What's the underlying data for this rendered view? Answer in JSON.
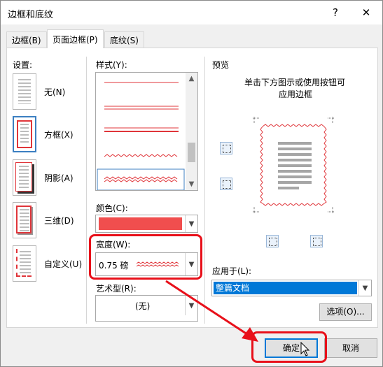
{
  "window": {
    "title": "边框和底纹",
    "help_button": "?",
    "close_button": "✕"
  },
  "tabs": [
    {
      "label": "边框(B)",
      "active": false
    },
    {
      "label": "页面边框(P)",
      "active": true
    },
    {
      "label": "底纹(S)",
      "active": false
    }
  ],
  "settings": {
    "label": "设置:",
    "items": [
      {
        "label": "无(N)"
      },
      {
        "label": "方框(X)"
      },
      {
        "label": "阴影(A)"
      },
      {
        "label": "三维(D)"
      },
      {
        "label": "自定义(U)"
      }
    ],
    "selected": "方框(X)"
  },
  "style": {
    "label": "样式(Y):",
    "selected": "wavy"
  },
  "color": {
    "label": "颜色(C):",
    "value": "#f04e4e"
  },
  "width": {
    "label": "宽度(W):",
    "value": "0.75 磅"
  },
  "art": {
    "label": "艺术型(R):",
    "value": "(无)"
  },
  "preview": {
    "label": "预览",
    "hint_line1": "单击下方图示或使用按钮可",
    "hint_line2": "应用边框"
  },
  "apply_to": {
    "label": "应用于(L):",
    "value": "整篇文档"
  },
  "buttons": {
    "options": "选项(O)...",
    "ok": "确定",
    "cancel": "取消"
  },
  "colors": {
    "accent": "#0078d7",
    "border_red": "#e0353a",
    "highlight_red": "#e8101a"
  }
}
